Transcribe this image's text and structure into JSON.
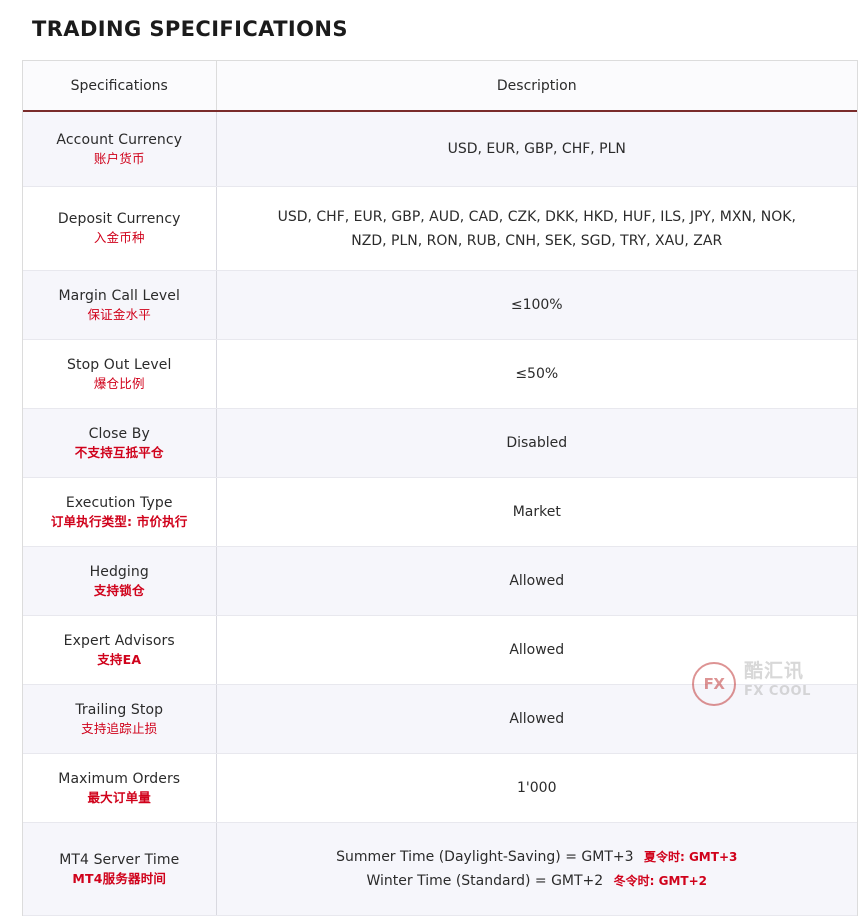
{
  "page": {
    "title": "TRADING SPECIFICATIONS"
  },
  "table": {
    "headers": {
      "spec": "Specifications",
      "desc": "Description"
    },
    "rows": [
      {
        "spec_en": "Account Currency",
        "spec_zh": "账户货币",
        "spec_zh_bold": false,
        "desc_lines": [
          "USD, EUR, GBP, CHF, PLN"
        ]
      },
      {
        "spec_en": "Deposit Currency",
        "spec_zh": "入金币种",
        "spec_zh_bold": false,
        "desc_lines": [
          "USD, CHF, EUR, GBP, AUD, CAD, CZK, DKK, HKD, HUF, ILS, JPY, MXN, NOK,",
          "NZD, PLN, RON, RUB, CNH, SEK, SGD, TRY, XAU, ZAR"
        ]
      },
      {
        "spec_en": "Margin Call Level",
        "spec_zh": "保证金水平",
        "spec_zh_bold": false,
        "desc_lines": [
          "≤100%"
        ]
      },
      {
        "spec_en": "Stop Out Level",
        "spec_zh": "爆仓比例",
        "spec_zh_bold": false,
        "desc_lines": [
          "≤50%"
        ]
      },
      {
        "spec_en": "Close By",
        "spec_zh": "不支持互抵平仓",
        "spec_zh_bold": true,
        "desc_lines": [
          "Disabled"
        ]
      },
      {
        "spec_en": "Execution Type",
        "spec_zh": "订单执行类型: 市价执行",
        "spec_zh_bold": true,
        "desc_lines": [
          "Market"
        ]
      },
      {
        "spec_en": "Hedging",
        "spec_zh": "支持锁仓",
        "spec_zh_bold": true,
        "desc_lines": [
          "Allowed"
        ]
      },
      {
        "spec_en": "Expert Advisors",
        "spec_zh": "支持EA",
        "spec_zh_bold": true,
        "desc_lines": [
          "Allowed"
        ]
      },
      {
        "spec_en": "Trailing Stop",
        "spec_zh": "支持追踪止损",
        "spec_zh_bold": false,
        "desc_lines": [
          "Allowed"
        ]
      },
      {
        "spec_en": "Maximum Orders",
        "spec_zh": "最大订单量",
        "spec_zh_bold": true,
        "desc_lines": [
          "1'000"
        ]
      },
      {
        "spec_en": "MT4 Server Time",
        "spec_zh": "MT4服务器时间",
        "spec_zh_bold": true,
        "desc_lines": [
          "Summer Time (Daylight-Saving) = GMT+3",
          "Winter Time (Standard) = GMT+2"
        ],
        "desc_annotations": [
          "夏令时: GMT+3",
          "冬令时: GMT+2"
        ]
      }
    ]
  },
  "watermark": {
    "badge": "FX",
    "cn": "酷汇讯",
    "en": "FX COOL"
  },
  "colors": {
    "accent_red": "#d0021b",
    "header_rule": "#7a2b2b",
    "stripe": "#f6f6fb",
    "border": "#dcdcdc"
  }
}
